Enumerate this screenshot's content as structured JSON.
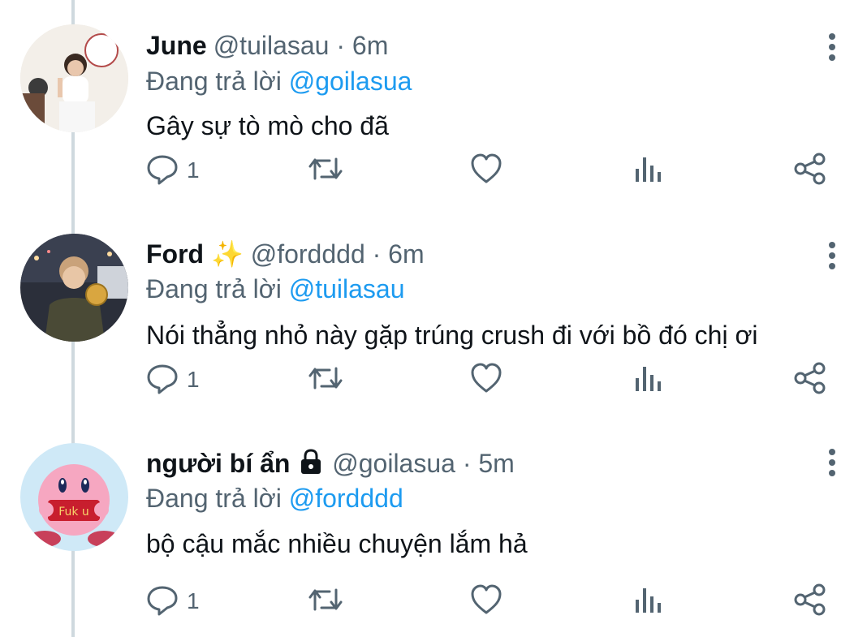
{
  "tweets": [
    {
      "name": "June",
      "badge": "",
      "handle": "@tuilasau",
      "time": "6m",
      "replying_label": "Đang trả lời",
      "replying_to": "@goilasua",
      "text": "Gây sự tò mò cho đã",
      "reply_count": "1",
      "avatar_icon": "user-photo-avatar"
    },
    {
      "name": "Ford",
      "badge": "✨",
      "handle": "@fordddd",
      "time": "6m",
      "replying_label": "Đang trả lời",
      "replying_to": "@tuilasau",
      "text": "Nói thẳng nhỏ này gặp trúng crush đi với bồ đó chị ơi",
      "reply_count": "1",
      "avatar_icon": "user-photo-avatar"
    },
    {
      "name": "người bí ẩn",
      "badge": "🔒",
      "handle": "@goilasua",
      "time": "5m",
      "replying_label": "Đang trả lời",
      "replying_to": "@fordddd",
      "text": "bộ cậu mắc nhiều chuyện lắm hả",
      "reply_count": "1",
      "avatar_icon": "kirby-avatar",
      "avatar_sign_text": "Fuk u"
    }
  ],
  "separator": "·",
  "colors": {
    "text": "#0f1419",
    "secondary": "#536471",
    "accent": "#1d9bf0",
    "thread_line": "#cfd9de"
  },
  "icons": [
    "reply-icon",
    "retweet-icon",
    "like-icon",
    "views-icon",
    "share-icon",
    "more-icon"
  ]
}
